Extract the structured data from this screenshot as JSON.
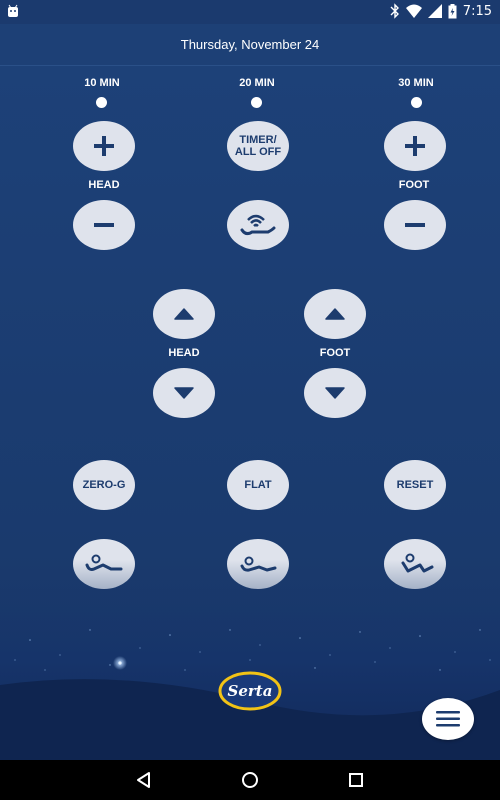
{
  "status_bar": {
    "time": "7:15",
    "icons": [
      "android-icon",
      "bluetooth-icon",
      "wifi-icon",
      "signal-icon",
      "battery-icon"
    ]
  },
  "header": {
    "date": "Thursday, November 24"
  },
  "timers": [
    {
      "label": "10 MIN"
    },
    {
      "label": "20 MIN"
    },
    {
      "label": "30 MIN"
    }
  ],
  "massage": {
    "head_label": "HEAD",
    "foot_label": "FOOT",
    "timer_button_line1": "TIMER/",
    "timer_button_line2": "ALL OFF"
  },
  "position": {
    "head_label": "HEAD",
    "foot_label": "FOOT"
  },
  "presets": {
    "zero_g": "ZERO-G",
    "flat": "FLAT",
    "reset": "RESET"
  },
  "brand": {
    "logo_text": "Serta"
  },
  "colors": {
    "background": "#1b3a6e",
    "button": "#dfe3ec",
    "button_icon": "#1d3c6e",
    "logo_ring": "#f2c316"
  }
}
